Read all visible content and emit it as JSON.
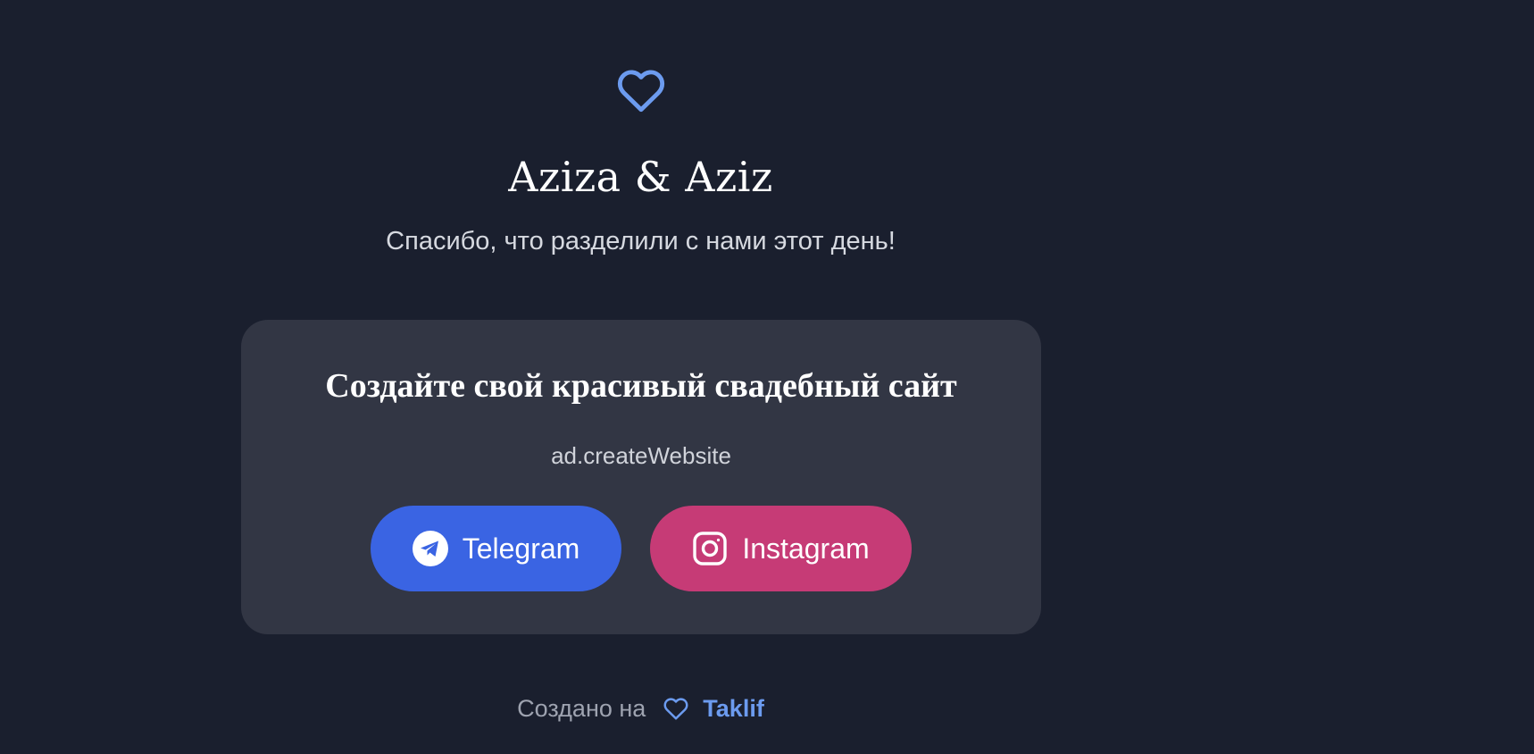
{
  "header": {
    "icon": "heart-icon",
    "title": "Aziza & Aziz",
    "subtitle": "Спасибо, что разделили с нами этот день!"
  },
  "ad": {
    "title": "Создайте свой красивый свадебный сайт",
    "subtitle": "ad.createWebsite",
    "buttons": {
      "telegram": {
        "label": "Telegram",
        "icon": "telegram-icon",
        "color": "#3a64e3"
      },
      "instagram": {
        "label": "Instagram",
        "icon": "instagram-icon",
        "color": "#c63b76"
      }
    }
  },
  "footer": {
    "created_on": "Создано на",
    "icon": "heart-icon",
    "brand": "Taklif"
  },
  "colors": {
    "background": "#1a1f2e",
    "card": "#323644",
    "accent": "#6c9bef"
  }
}
